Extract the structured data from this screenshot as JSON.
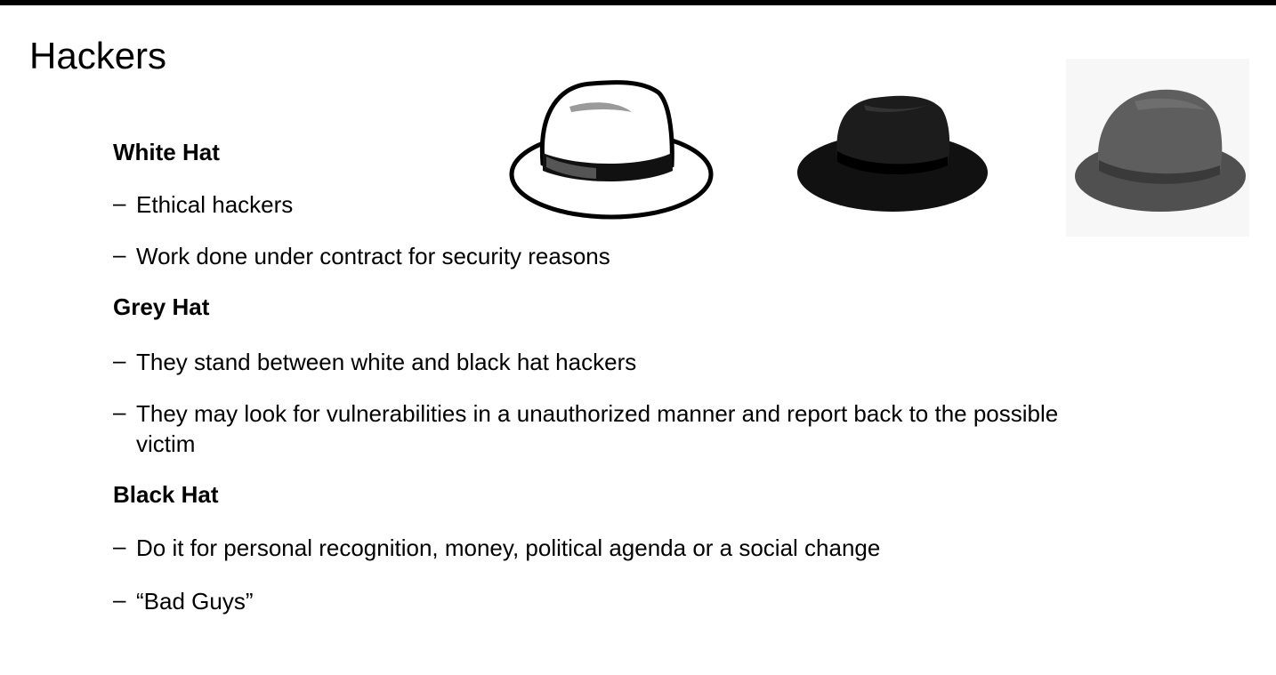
{
  "slide": {
    "title": "Hackers",
    "sections": [
      {
        "heading": "White Hat",
        "bullets": [
          "Ethical hackers",
          "Work done under contract for security reasons"
        ]
      },
      {
        "heading": "Grey Hat",
        "bullets": [
          "They stand between white and black hat hackers",
          "They may look for vulnerabilities in a unauthorized manner and report back to the possible victim"
        ]
      },
      {
        "heading": "Black Hat",
        "bullets": [
          "Do it for personal recognition, money, political agenda or a social change",
          "“Bad Guys”"
        ]
      }
    ],
    "dash": "–",
    "images": [
      {
        "icon": "white-fedora-hat-icon",
        "color": "#ffffff"
      },
      {
        "icon": "black-fedora-hat-icon",
        "color": "#111111"
      },
      {
        "icon": "grey-fedora-hat-icon",
        "color": "#555555"
      }
    ]
  }
}
